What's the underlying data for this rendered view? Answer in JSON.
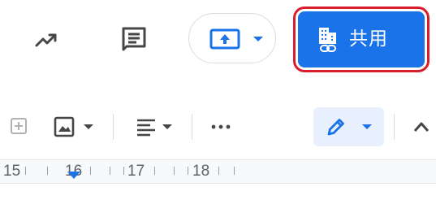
{
  "header": {
    "trend_icon": "trending-up-icon",
    "comment_icon": "comment-icon",
    "present_icon": "present-upload-icon",
    "present_dropdown_icon": "caret-down-icon",
    "share": {
      "label": "共用",
      "icon": "building-link-icon",
      "background": "#1a73e8",
      "highlight_color": "#d81e2c"
    }
  },
  "toolbar": {
    "items": [
      {
        "icon": "add-image-icon"
      },
      {
        "icon": "image-icon",
        "dropdown": true
      },
      {
        "icon": "align-left-icon",
        "dropdown": true
      },
      {
        "icon": "more-horiz-icon"
      },
      {
        "icon": "pencil-icon",
        "dropdown": true,
        "active_bg": "#e8f0fe"
      },
      {
        "icon": "chevron-up-icon"
      }
    ]
  },
  "ruler": {
    "labels": [
      "15",
      "16",
      "17",
      "18"
    ]
  },
  "colors": {
    "icon": "#444746",
    "blue": "#1a73e8",
    "text": "#5f6368"
  }
}
